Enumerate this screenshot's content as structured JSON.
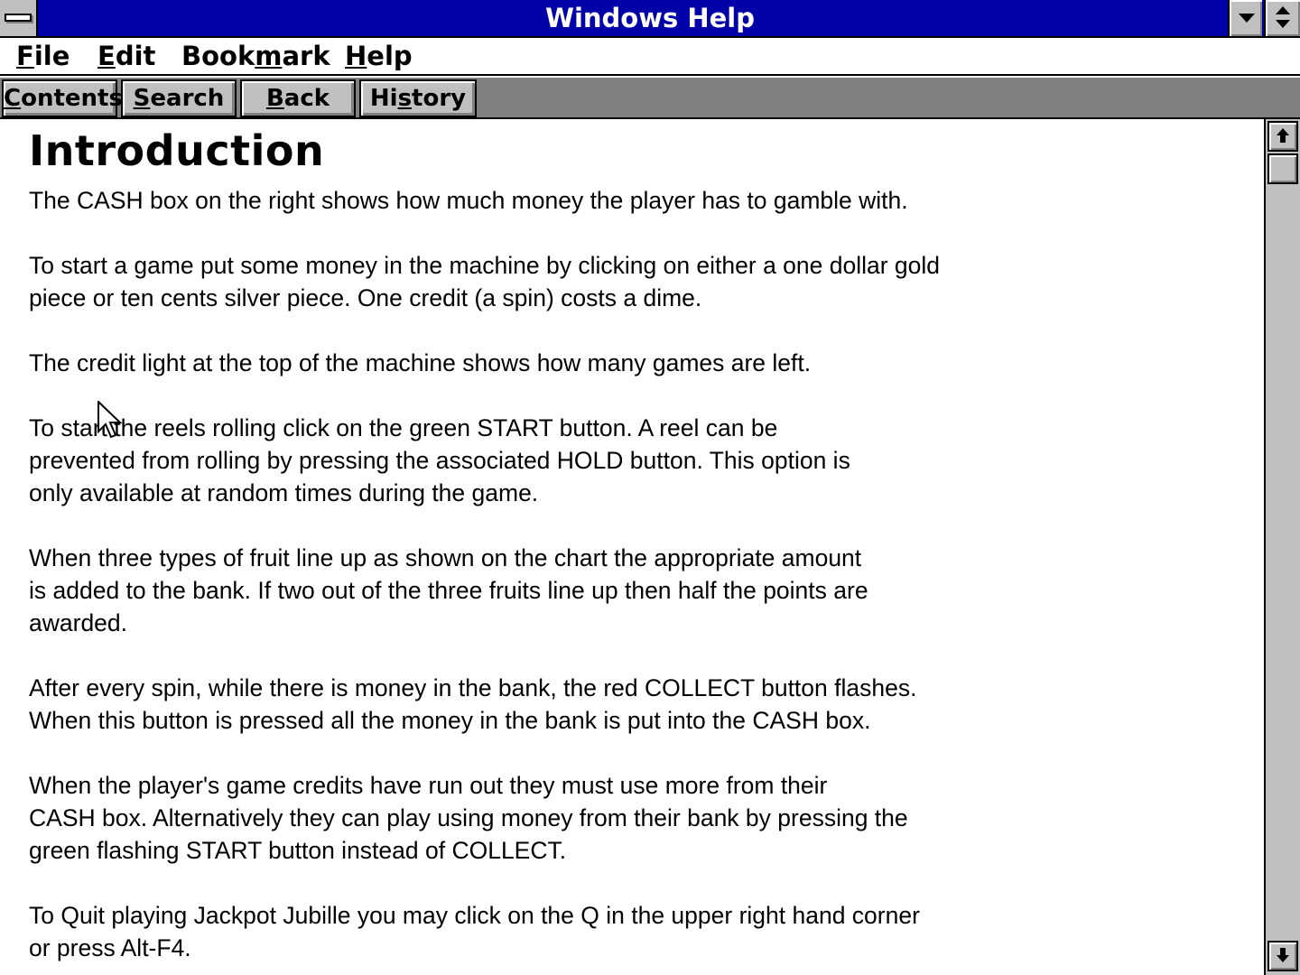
{
  "window": {
    "title": "Windows Help"
  },
  "menubar": {
    "items": [
      {
        "pre": "",
        "key": "F",
        "post": "ile"
      },
      {
        "pre": "",
        "key": "E",
        "post": "dit"
      },
      {
        "pre": "Book",
        "key": "m",
        "post": "ark"
      },
      {
        "pre": "",
        "key": "H",
        "post": "elp"
      }
    ]
  },
  "buttonbar": {
    "buttons": [
      {
        "pre": "",
        "key": "C",
        "post": "ontents"
      },
      {
        "pre": "",
        "key": "S",
        "post": "earch"
      },
      {
        "pre": "",
        "key": "B",
        "post": "ack"
      },
      {
        "pre": "Hi",
        "key": "s",
        "post": "tory"
      }
    ]
  },
  "topic": {
    "heading": "Introduction",
    "paragraphs": [
      "The CASH box on the right shows how much money the player has to gamble with.",
      "To start a game put some money in the machine by clicking on either a one dollar gold\npiece or ten cents silver piece.  One credit (a spin) costs a dime.",
      "The credit light at the top of the machine shows how many games are left.",
      "To start the reels rolling click on the green START button.  A reel can be\nprevented from rolling by pressing the associated HOLD button.  This option is\nonly available at random times during the game.",
      "When three types of fruit line up as shown on the chart the appropriate amount\nis added to the bank.  If two out of the three fruits line up then half the points are\nawarded.",
      "After every spin, while there is money in the bank, the red COLLECT button flashes.\nWhen this button is pressed all the money in the bank is put into the CASH box.",
      "When the player's game credits have run out they must use more from their\nCASH box.  Alternatively they can play using money from their bank by pressing the\ngreen flashing START button instead of COLLECT.",
      "To Quit playing Jackpot Jubille you may click on the Q in the upper right hand corner\nor press Alt-F4."
    ]
  },
  "icons": {
    "system_menu": "system-menu-icon",
    "minimize": "minimize-icon",
    "restore": "restore-icon",
    "scroll_up": "scroll-up-arrow-icon",
    "scroll_down": "scroll-down-arrow-icon",
    "cursor": "mouse-pointer-icon"
  },
  "colors": {
    "titlebar": "#0000a8",
    "button_face": "#c0c0c0",
    "button_bar": "#808080"
  }
}
